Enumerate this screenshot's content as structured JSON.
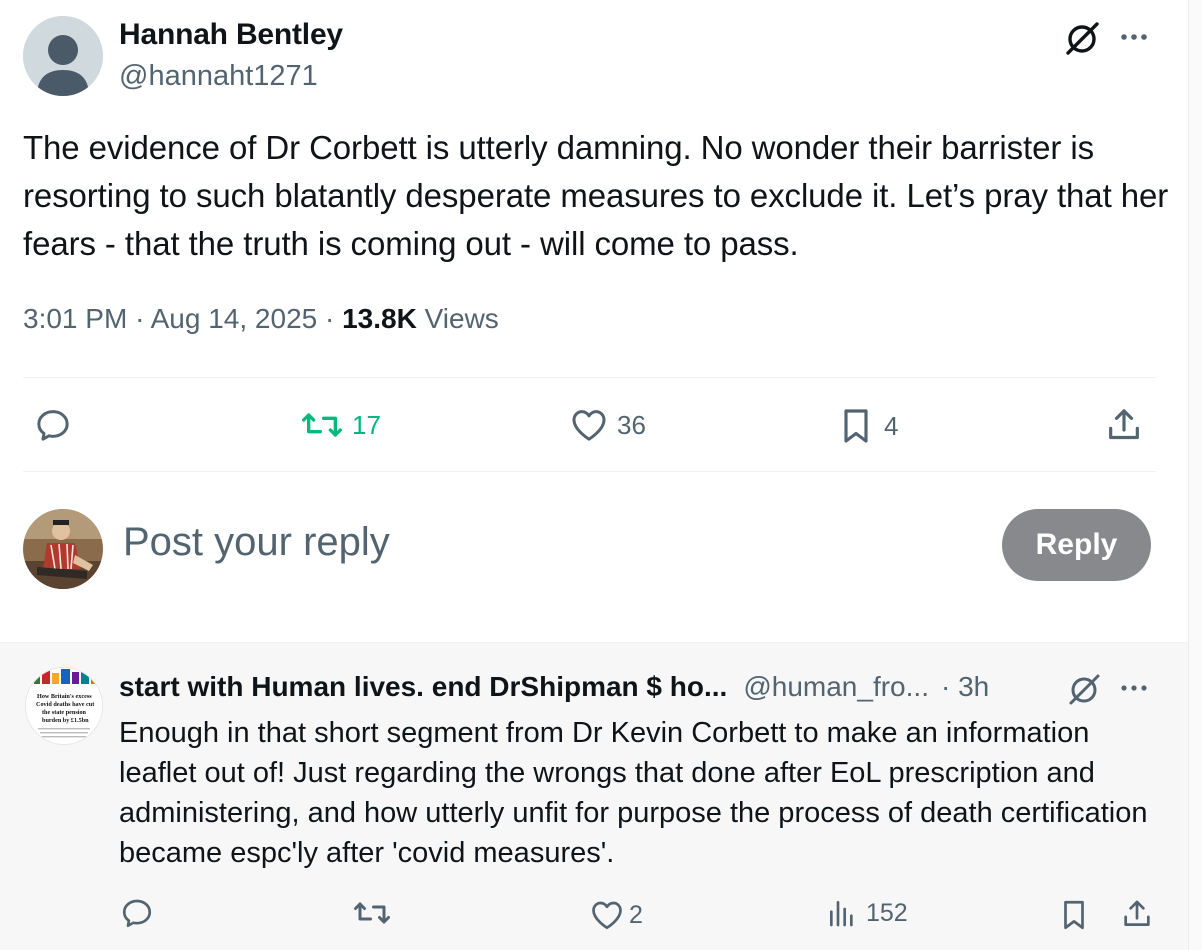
{
  "tweet": {
    "author_name": "Hannah Bentley",
    "author_handle": "@hannaht1271",
    "text": "The evidence of Dr Corbett is utterly damning. No wonder their barrister is resorting to such blatantly desperate measures to exclude it. Let’s pray that her fears - that the truth is coming out - will come to pass.",
    "time": "3:01 PM",
    "date": "Aug 14, 2025",
    "views_count": "13.8K",
    "views_label": "Views",
    "retweets": "17",
    "likes": "36",
    "bookmarks": "4"
  },
  "reply_box": {
    "placeholder": "Post your reply",
    "button_label": "Reply"
  },
  "reply": {
    "author_name": "start with Human lives. end DrShipman $ ho...",
    "author_handle": "@human_fro...",
    "time": "· 3h",
    "text": "Enough in that short segment from Dr Kevin Corbett to make an information leaflet out of!   Just regarding the wrongs that done after EoL prescription and administering, and how utterly unfit for purpose the process of death certification became espc'ly after 'covid measures'.",
    "likes": "2",
    "views": "152",
    "avatar_text": {
      "line1": "How Britain's excess",
      "line2": "Covid deaths have cut",
      "line3": "the state pension",
      "line4": "burden by £1.5bn"
    }
  },
  "colors": {
    "text_primary": "#0f1419",
    "text_secondary": "#536471",
    "retweet_green": "#00ba7c",
    "reply_button": "#87898c"
  }
}
